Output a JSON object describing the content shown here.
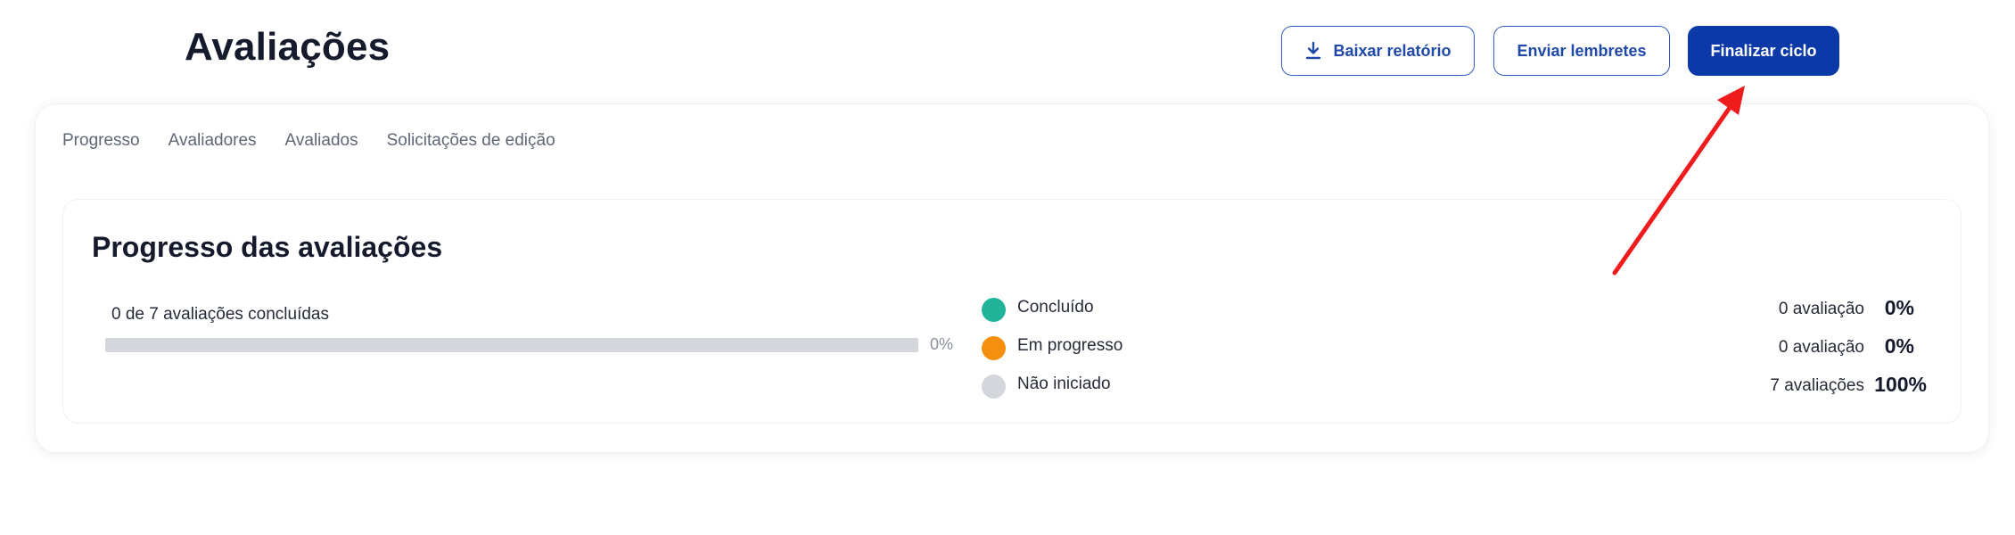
{
  "header": {
    "title": "Avaliações"
  },
  "actions": {
    "download_label": "Baixar relatório",
    "remind_label": "Enviar lembretes",
    "finalize_label": "Finalizar ciclo"
  },
  "tabs": [
    {
      "label": "Progresso"
    },
    {
      "label": "Avaliadores"
    },
    {
      "label": "Avaliados"
    },
    {
      "label": "Solicitações de edição"
    }
  ],
  "progress": {
    "title": "Progresso das avaliações",
    "summary": "0 de 7 avaliações concluídas",
    "percent_label": "0%",
    "percent_value": 0,
    "legend": [
      {
        "label": "Concluído",
        "count": "0 avaliação",
        "percent": "0%",
        "color": "#1fb39a"
      },
      {
        "label": "Em progresso",
        "count": "0 avaliação",
        "percent": "0%",
        "color": "#f5900f"
      },
      {
        "label": "Não iniciado",
        "count": "7 avaliações",
        "percent": "100%",
        "color": "#d3d6db"
      }
    ]
  },
  "colors": {
    "primary": "#0b3aa8",
    "outline": "#2e5fc0",
    "annotation_arrow": "#ee1c1c"
  },
  "icons": {
    "download": "download-icon"
  }
}
